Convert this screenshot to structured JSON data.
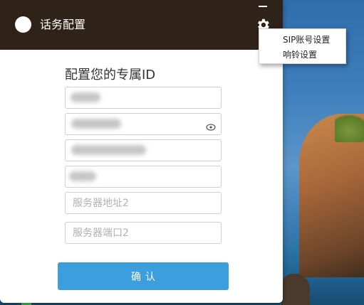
{
  "window": {
    "title": "话务配置"
  },
  "form": {
    "heading": "配置您的专属ID",
    "fields": [
      {
        "name": "field-1",
        "value": "",
        "placeholder": "",
        "obscured": true
      },
      {
        "name": "password",
        "value": "",
        "placeholder": "",
        "obscured": true
      },
      {
        "name": "field-3",
        "value": "",
        "placeholder": "",
        "obscured": true
      },
      {
        "name": "field-4",
        "value": "",
        "placeholder": "",
        "obscured": true
      },
      {
        "name": "server-address-2",
        "value": "",
        "placeholder": "服务器地址2"
      },
      {
        "name": "server-port-2",
        "value": "",
        "placeholder": "服务器端口2"
      }
    ],
    "confirm_label": "确认"
  },
  "settings_menu": {
    "items": [
      {
        "label": "SIP账号设置"
      },
      {
        "label": "响铃设置"
      }
    ]
  },
  "colors": {
    "titlebar": "#2f2218",
    "accent": "#3a9fdc"
  },
  "icons": [
    "minimize-icon",
    "gear-icon",
    "eye-icon"
  ]
}
